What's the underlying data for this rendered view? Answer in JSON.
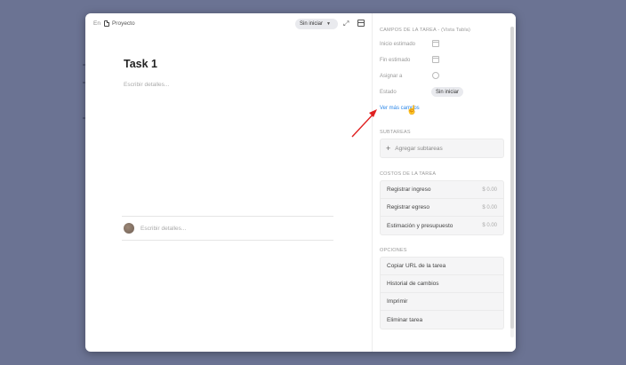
{
  "breadcrumb": {
    "prefix": "En",
    "project": "Proyecto"
  },
  "header": {
    "status": "Sin iniciar"
  },
  "task": {
    "title": "Task 1",
    "description_placeholder": "Escribir detalles..."
  },
  "comment": {
    "placeholder": "Escribir detalles..."
  },
  "fields": {
    "heading": "CAMPOS DE LA TAREA - (Vista Tabla)",
    "start_label": "Inicio estimado",
    "end_label": "Fin estimado",
    "assign_label": "Asignar a",
    "state_label": "Estado",
    "state_value": "Sin iniciar",
    "more_link": "Ver más campos"
  },
  "subtasks": {
    "heading": "SUBTAREAS",
    "add_label": "Agregar subtareas"
  },
  "costs": {
    "heading": "COSTOS DE LA TAREA",
    "rows": [
      {
        "label": "Registrar ingreso",
        "amount": "$ 0.00"
      },
      {
        "label": "Registrar egreso",
        "amount": "$ 0.00"
      },
      {
        "label": "Estimación y presupuesto",
        "amount": "$ 0.00"
      }
    ]
  },
  "options": {
    "heading": "OPCIONES",
    "items": [
      "Copiar URL de la tarea",
      "Historial de cambios",
      "Imprimir",
      "Eliminar tarea"
    ]
  },
  "colors": {
    "backdrop": "#6b7393",
    "link": "#2a86e8",
    "arrow": "#e02020"
  }
}
